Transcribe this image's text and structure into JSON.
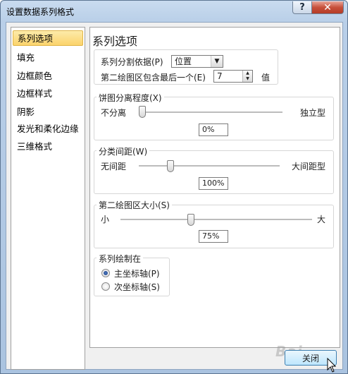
{
  "window": {
    "title": "设置数据系列格式",
    "help_glyph": "?",
    "close_glyph": "✕"
  },
  "nav": {
    "items": [
      {
        "label": "系列选项",
        "selected": true
      },
      {
        "label": "填充"
      },
      {
        "label": "边框颜色"
      },
      {
        "label": "边框样式"
      },
      {
        "label": "阴影"
      },
      {
        "label": "发光和柔化边缘"
      },
      {
        "label": "三维格式"
      }
    ]
  },
  "panel": {
    "heading": "系列选项",
    "split": {
      "label": "系列分割依据(P)",
      "value": "位置",
      "second_label": "第二绘图区包含最后一个(E)",
      "second_value": "7",
      "second_unit": "值"
    },
    "explosion": {
      "legend": "饼图分离程度(X)",
      "left": "不分离",
      "right": "独立型",
      "value": "0%",
      "fraction": 0.0
    },
    "gap": {
      "legend": "分类间距(W)",
      "left": "无间距",
      "right": "大间距型",
      "value": "100%",
      "fraction": 0.2
    },
    "size": {
      "legend": "第二绘图区大小(S)",
      "left": "小",
      "right": "大",
      "value": "75%",
      "fraction": 0.35
    },
    "plot_on": {
      "legend": "系列绘制在",
      "primary": "主坐标轴(P)",
      "secondary": "次坐标轴(S)",
      "selected": "primary"
    }
  },
  "footer": {
    "close_label": "关闭"
  },
  "watermark": {
    "text": "Bai",
    "sub": "经验"
  },
  "colors": {
    "accent": "#fbd36b",
    "title_bar": "#b9cfe8",
    "close_red": "#c7503b"
  }
}
